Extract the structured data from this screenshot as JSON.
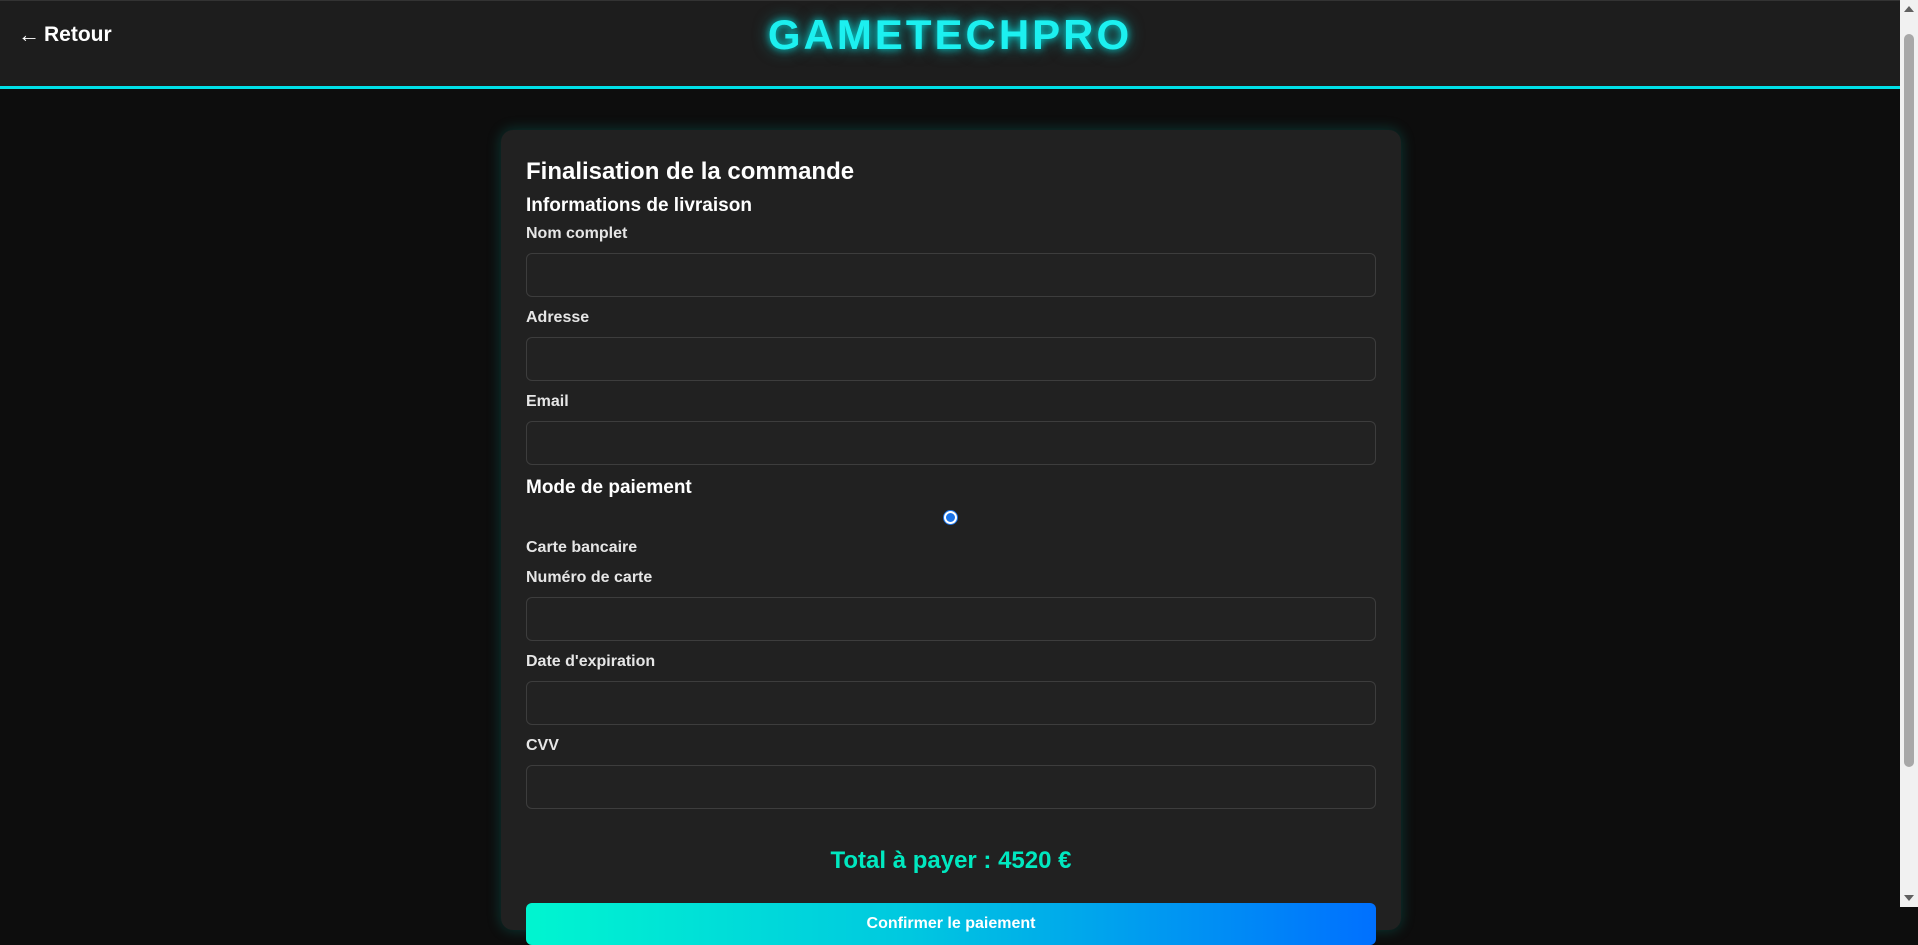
{
  "header": {
    "back_label": "Retour",
    "back_arrow": "←",
    "brand": "GAMETECHPRO"
  },
  "checkout": {
    "title": "Finalisation de la commande",
    "shipping": {
      "title": "Informations de livraison",
      "fields": [
        {
          "label": "Nom complet",
          "value": ""
        },
        {
          "label": "Adresse",
          "value": ""
        },
        {
          "label": "Email",
          "value": ""
        }
      ]
    },
    "payment": {
      "title": "Mode de paiement",
      "option_label": "Carte bancaire",
      "option_selected": true,
      "fields": [
        {
          "label": "Numéro de carte",
          "value": ""
        },
        {
          "label": "Date d'expiration",
          "value": ""
        },
        {
          "label": "CVV",
          "value": ""
        }
      ]
    },
    "total": "Total à payer : 4520 €",
    "confirm_label": "Confirmer le paiement"
  },
  "colors": {
    "accent": "#1cf0f0",
    "total": "#00e8c0",
    "button_gradient_start": "#00f5d0",
    "button_gradient_end": "#0070ff",
    "background": "#0d0d0d",
    "card": "#212121"
  }
}
